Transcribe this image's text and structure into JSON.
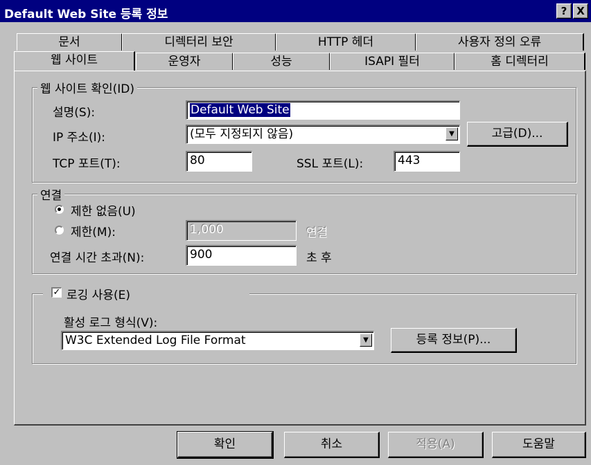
{
  "window": {
    "title": "Default Web Site 등록 정보",
    "help_label": "?",
    "close_label": "X"
  },
  "tabs": {
    "row1": [
      "문서",
      "디렉터리 보안",
      "HTTP 헤더",
      "사용자 정의 오류"
    ],
    "row2": [
      "웹 사이트",
      "운영자",
      "성능",
      "ISAPI 필터",
      "홈 디렉터리"
    ]
  },
  "site_id": {
    "legend": "웹 사이트 확인(ID)",
    "description_label": "설명(S):",
    "description_value": "Default Web Site",
    "ip_label": "IP 주소(I):",
    "ip_value": "(모두 지정되지 않음)",
    "advanced_button": "고급(D)...",
    "tcp_label": "TCP 포트(T):",
    "tcp_value": "80",
    "ssl_label": "SSL 포트(L):",
    "ssl_value": "443"
  },
  "connection": {
    "legend": "연결",
    "unlimited_label": "제한 없음(U)",
    "unlimited_selected": true,
    "limited_label": "제한(M):",
    "limited_value": "1,000",
    "limited_unit": "연결",
    "timeout_label": "연결 시간 초과(N):",
    "timeout_value": "900",
    "timeout_unit": "초 후"
  },
  "logging": {
    "enable_label": "로깅 사용(E)",
    "enabled": true,
    "format_label": "활성 로그 형식(V):",
    "format_value": "W3C Extended Log File Format",
    "properties_button": "등록 정보(P)..."
  },
  "buttons": {
    "ok": "확인",
    "cancel": "취소",
    "apply": "적용(A)",
    "help": "도움말"
  }
}
